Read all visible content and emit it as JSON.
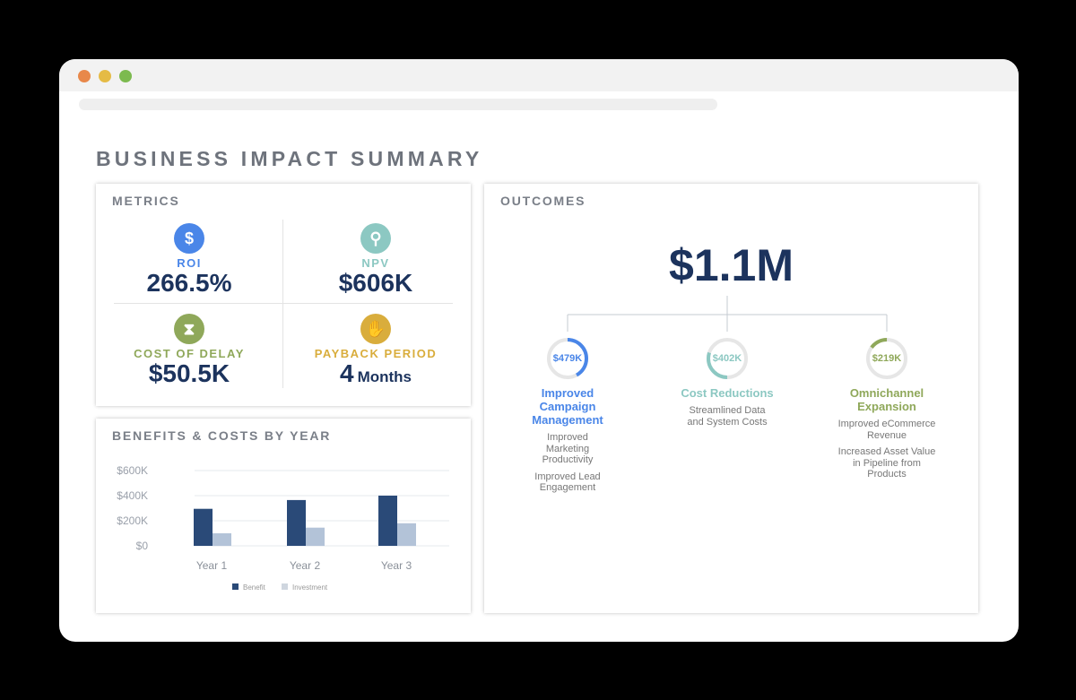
{
  "window": {
    "dots": [
      "#e8884a",
      "#e5bb45",
      "#7cba4f"
    ]
  },
  "title": "BUSINESS IMPACT SUMMARY",
  "metrics": {
    "title": "METRICS",
    "items": [
      {
        "icon": "dollar-icon",
        "label": "ROI",
        "value": "266.5%",
        "color": "#4a86e8"
      },
      {
        "icon": "location-pin-icon",
        "label": "NPV",
        "value": "$606K",
        "color": "#8cc8c2"
      },
      {
        "icon": "hourglass-icon",
        "label": "COST OF DELAY",
        "value": "$50.5K",
        "color": "#8fa85a"
      },
      {
        "icon": "hand-coin-icon",
        "label": "PAYBACK PERIOD",
        "value": "4",
        "unit": "Months",
        "color": "#d9ad3c"
      }
    ]
  },
  "chart_data": {
    "type": "bar",
    "title": "BENEFITS & COSTS BY YEAR",
    "categories": [
      "Year 1",
      "Year 2",
      "Year 3"
    ],
    "series": [
      {
        "name": "Benefit",
        "values": [
          295,
          365,
          400
        ],
        "color": "#2a4a78"
      },
      {
        "name": "Investment",
        "values": [
          100,
          145,
          180
        ],
        "color": "#b3c3d8"
      }
    ],
    "yticks": [
      "$0",
      "$200K",
      "$400K",
      "$600K"
    ],
    "ylim": [
      0,
      600
    ],
    "units": "$K",
    "legend": "bottom"
  },
  "outcomes": {
    "title": "OUTCOMES",
    "total": "$1.1M",
    "items": [
      {
        "value": "$479K",
        "fraction": 0.42,
        "name": "Improved Campaign Management",
        "color": "#4a86e8",
        "details": [
          "Improved Marketing Productivity",
          "Improved Lead Engagement"
        ]
      },
      {
        "value": "$402K",
        "fraction": 0.3,
        "name": "Cost Reductions",
        "color": "#8cc8c2",
        "details": [
          "Streamlined Data and System Costs"
        ]
      },
      {
        "value": "$219K",
        "fraction": 0.15,
        "name": "Omnichannel Expansion",
        "color": "#8fa85a",
        "details": [
          "Improved eCommerce Revenue",
          "Increased Asset Value in Pipeline from Products"
        ]
      }
    ]
  }
}
